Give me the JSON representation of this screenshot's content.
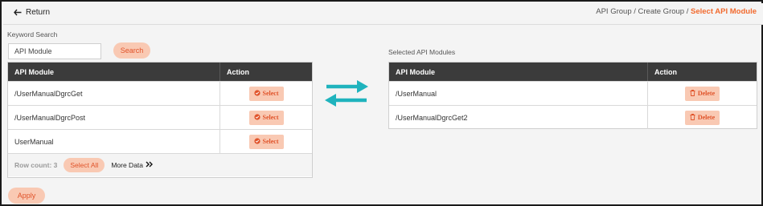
{
  "header": {
    "return_label": "Return",
    "breadcrumb": {
      "part1": "API Group / Create Group / ",
      "active": "Select API Module"
    }
  },
  "search": {
    "label": "Keyword Search",
    "value": "API Module",
    "button_label": "Search"
  },
  "left_table": {
    "col_module": "API Module",
    "col_action": "Action",
    "rows": [
      {
        "module": "/UserManualDgrcGet",
        "action": "Select"
      },
      {
        "module": "/UserManualDgrcPost",
        "action": "Select"
      },
      {
        "module": "UserManual",
        "action": "Select"
      }
    ],
    "row_count_label": "Row count: 3",
    "select_all_label": "Select All",
    "more_data_label": "More Data"
  },
  "right_table": {
    "label": "Selected API Modules",
    "col_module": "API Module",
    "col_action": "Action",
    "rows": [
      {
        "module": "/UserManual",
        "action": "Delete"
      },
      {
        "module": "/UserManualDgrcGet2",
        "action": "Delete"
      }
    ]
  },
  "apply_label": "Apply",
  "colors": {
    "accent": "#f26a2e",
    "pill_bg": "#f9c9b3",
    "pill_text": "#e0532a",
    "header_dark": "#3b3b3b",
    "transfer_teal": "#1fb3bd"
  },
  "icons": [
    "arrow-left-icon",
    "check-circle-icon",
    "trash-icon",
    "double-chevron-right-icon",
    "transfer-arrows-icon"
  ]
}
